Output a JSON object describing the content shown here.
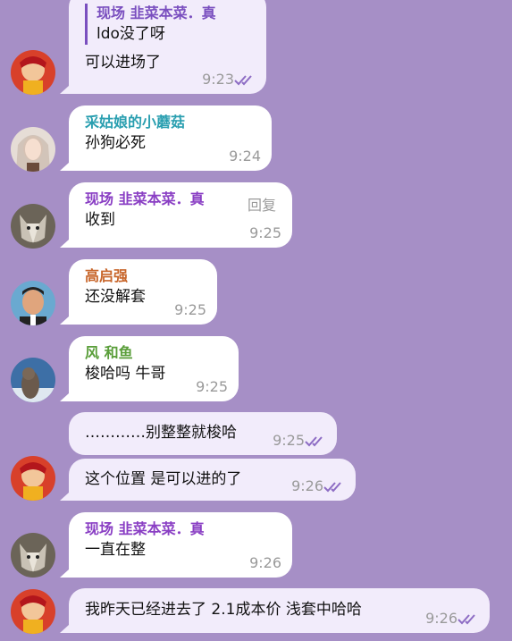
{
  "colors": {
    "background": "#a68fc6",
    "bubble_other": "#ffffff",
    "bubble_own": "#f2ecfb",
    "sender_purple": "#8a3fc4",
    "sender_teal": "#2a9fb0",
    "sender_orange": "#c8662b",
    "sender_green": "#5a9e3a",
    "check": "#8d6cc4"
  },
  "messages": [
    {
      "quote_sender": "现场 韭菜本菜．真",
      "quote_text": "ldo没了呀",
      "text": "可以进场了",
      "time": "9:23",
      "read": "double-check-icon"
    },
    {
      "sender": "采姑娘的小蘑菇",
      "text": "孙狗必死",
      "time": "9:24"
    },
    {
      "sender": "现场 韭菜本菜．真",
      "reply": "回复",
      "text": "收到",
      "time": "9:25"
    },
    {
      "sender": "高启强",
      "text": "还没解套",
      "time": "9:25"
    },
    {
      "sender": "风 和鱼",
      "text": "梭哈吗 牛哥",
      "time": "9:25"
    },
    {
      "text": "…………别整整就梭哈",
      "time": "9:25",
      "read": "double-check-icon"
    },
    {
      "text": "这个位置 是可以进的了",
      "time": "9:26",
      "read": "double-check-icon"
    },
    {
      "sender": "现场 韭菜本菜．真",
      "text": "一直在整",
      "time": "9:26"
    },
    {
      "text": "我昨天已经进去了 2.1成本价  浅套中哈哈",
      "time": "9:26",
      "read": "double-check-icon"
    }
  ]
}
